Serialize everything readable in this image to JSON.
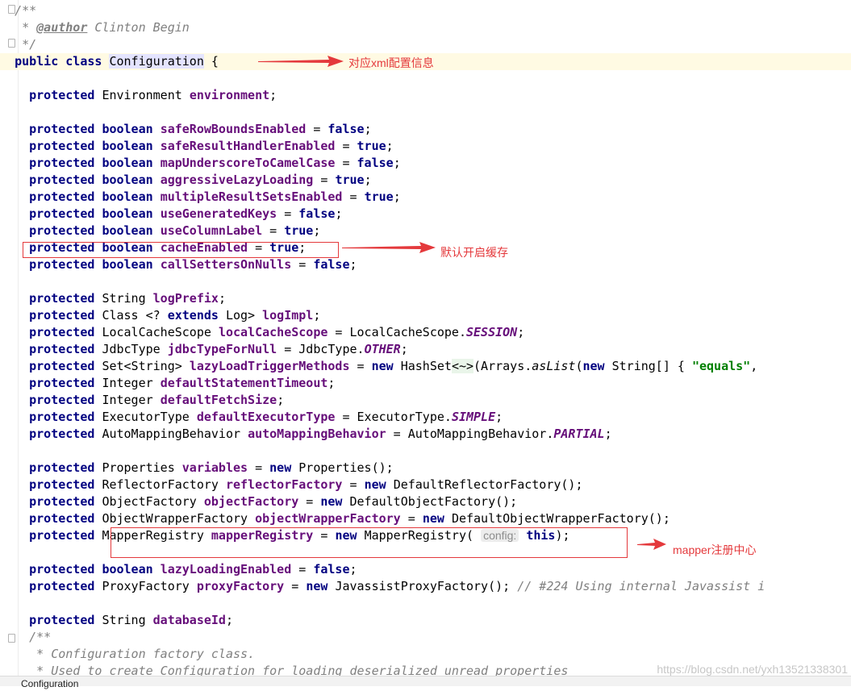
{
  "editor": {
    "comment": {
      "open": "/**",
      "star": " * ",
      "author_tag": "@author",
      "author_name": " Clinton Begin",
      "close": " */"
    },
    "class_decl": {
      "public_class": "public class",
      "name": "Configuration",
      "brace": " {"
    },
    "kw": {
      "protected": "protected",
      "boolean": "boolean",
      "new": "new",
      "this": "this",
      "extends": "extends",
      "false": "false",
      "true": "true"
    },
    "fields": {
      "environment": {
        "type": "Environment",
        "name": "environment"
      },
      "safeRowBoundsEnabled": "safeRowBoundsEnabled",
      "safeResultHandlerEnabled": "safeResultHandlerEnabled",
      "mapUnderscoreToCamelCase": "mapUnderscoreToCamelCase",
      "aggressiveLazyLoading": "aggressiveLazyLoading",
      "multipleResultSetsEnabled": "multipleResultSetsEnabled",
      "useGeneratedKeys": "useGeneratedKeys",
      "useColumnLabel": "useColumnLabel",
      "cacheEnabled": "cacheEnabled",
      "callSettersOnNulls": "callSettersOnNulls",
      "logPrefix": {
        "type": "String",
        "name": "logPrefix"
      },
      "logImpl": {
        "type_a": "Class <? ",
        "type_b": " Log> ",
        "name": "logImpl"
      },
      "localCacheScope": {
        "type": "LocalCacheScope",
        "name": "localCacheScope",
        "value_cls": "LocalCacheScope.",
        "value": "SESSION"
      },
      "jdbcTypeForNull": {
        "type": "JdbcType",
        "name": "jdbcTypeForNull",
        "value_cls": "JdbcType.",
        "value": "OTHER"
      },
      "lazyLoadTriggerMethods": {
        "type": "Set<String>",
        "name": "lazyLoadTriggerMethods",
        "init_a": "HashSet",
        "diamond": "<~>",
        "init_b": "(Arrays.",
        "as_list": "asList",
        "init_c": "(",
        "init_d": " String[] { ",
        "str": "\"equals\"",
        "tail": ","
      },
      "defaultStatementTimeout": {
        "type": "Integer",
        "name": "defaultStatementTimeout"
      },
      "defaultFetchSize": {
        "type": "Integer",
        "name": "defaultFetchSize"
      },
      "defaultExecutorType": {
        "type": "ExecutorType",
        "name": "defaultExecutorType",
        "value_cls": "ExecutorType.",
        "value": "SIMPLE"
      },
      "autoMappingBehavior": {
        "type": "AutoMappingBehavior",
        "name": "autoMappingBehavior",
        "value_cls": "AutoMappingBehavior.",
        "value": "PARTIAL"
      },
      "variables": {
        "type": "Properties",
        "name": "variables",
        "init": "Properties();"
      },
      "reflectorFactory": {
        "type": "ReflectorFactory",
        "name": "reflectorFactory",
        "init": "DefaultReflectorFactory();"
      },
      "objectFactory": {
        "type": "ObjectFactory",
        "name": "objectFactory",
        "init": "DefaultObjectFactory();"
      },
      "objectWrapperFactory": {
        "type": "ObjectWrapperFactory",
        "name": "objectWrapperFactory",
        "init": "DefaultObjectWrapperFactory();"
      },
      "mapperRegistry": {
        "type": "MapperRegistry",
        "name": "mapperRegistry",
        "init": "MapperRegistry(",
        "hint": "config:",
        "end": ");"
      },
      "lazyLoadingEnabled": "lazyLoadingEnabled",
      "proxyFactory": {
        "type": "ProxyFactory",
        "name": "proxyFactory",
        "init": "JavassistProxyFactory();",
        "comment": "// #224 Using internal Javassist i"
      },
      "databaseId": {
        "type": "String",
        "name": "databaseId"
      }
    },
    "doc_comment": {
      "open": "/**",
      "line1": " * Configuration factory class.",
      "line2": " * Used to create Configuration for loading deserialized unread properties"
    }
  },
  "annotations": {
    "class_note": "对应xml配置信息",
    "cache_note": "默认开启缓存",
    "mapper_note": "mapper注册中心"
  },
  "status_bar": {
    "breadcrumb": "Configuration"
  },
  "watermark": "https://blog.csdn.net/yxh13521338301",
  "colors": {
    "keyword": "#000080",
    "field": "#660e7a",
    "comment": "#808080",
    "string": "#008000",
    "annotation": "#e4393c",
    "current_line": "#fffae3"
  }
}
